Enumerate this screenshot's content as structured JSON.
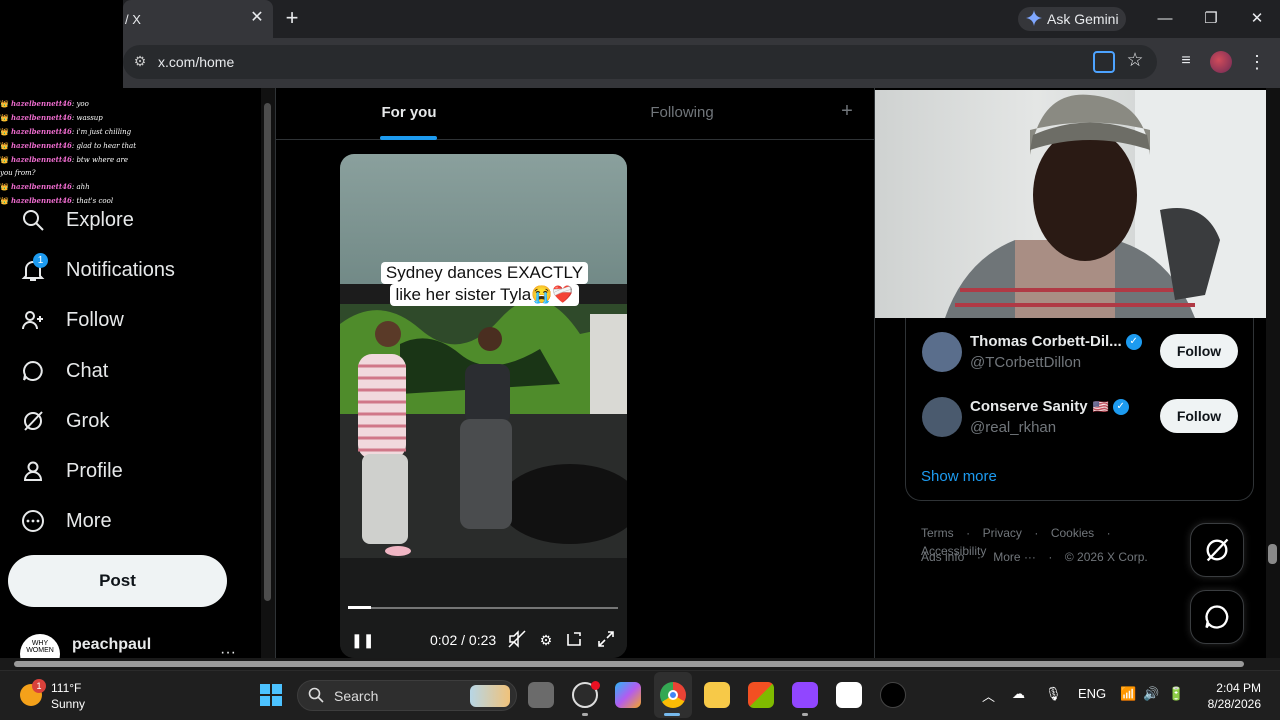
{
  "browser": {
    "tab_title": "/ X",
    "tab_close": "✕",
    "new_tab": "+",
    "gemini_label": "Ask Gemini",
    "url": "x.com/home",
    "window_controls": {
      "minimize": "—",
      "restore": "❐",
      "close": "✕"
    }
  },
  "chat_overlay": {
    "lines": [
      {
        "user": "hazelbennett46",
        "text": "yoo"
      },
      {
        "user": "hazelbennett46",
        "text": "wassup"
      },
      {
        "user": "hazelbennett46",
        "text": "i'm just chilling"
      },
      {
        "user": "hazelbennett46",
        "text": "glad to hear that"
      },
      {
        "user": "hazelbennett46",
        "text": "btw where are"
      },
      {
        "user": "",
        "text": "you from?"
      },
      {
        "user": "hazelbennett46",
        "text": "ahh"
      },
      {
        "user": "hazelbennett46",
        "text": "that's cool"
      }
    ]
  },
  "nav": {
    "explore": "Explore",
    "notifications": "Notifications",
    "notifications_badge": "1",
    "follow": "Follow",
    "chat": "Chat",
    "grok": "Grok",
    "profile": "Profile",
    "more": "More",
    "post": "Post",
    "account_name": "peachpaul",
    "account_avatar_text": "WHY WOMEN",
    "account_more": "···"
  },
  "timeline": {
    "tab_for_you": "For you",
    "tab_following": "Following",
    "tab_add": "+"
  },
  "video": {
    "caption_line1": "Sydney dances EXACTLY",
    "caption_line2": "like her sister Tyla😭❤️‍🩹",
    "time": "0:02 / 0:23",
    "progress": 0.087
  },
  "who_to_follow": [
    {
      "name": "Thomas Corbett-Dil...",
      "handle": "@TCorbettDillon",
      "button": "Follow",
      "flag": ""
    },
    {
      "name": "Conserve Sanity",
      "handle": "@real_rkhan",
      "button": "Follow",
      "flag": "🇺🇸"
    }
  ],
  "show_more": "Show more",
  "footer": {
    "terms": "Terms",
    "privacy": "Privacy",
    "cookies": "Cookies",
    "accessibility": "Accessibility",
    "ads_info": "Ads info",
    "more": "More ···",
    "copyright": "© 2026 X Corp.",
    "separator": "·"
  },
  "taskbar": {
    "weather_badge": "1",
    "weather_temp": "111°F",
    "weather_cond": "Sunny",
    "search": "Search",
    "language": "ENG",
    "time": "2:04 PM",
    "date": "8/28/2026"
  },
  "colors": {
    "accent": "#1d9bf0",
    "background": "#000000",
    "text": "#e7e9ea",
    "muted": "#71767b"
  }
}
